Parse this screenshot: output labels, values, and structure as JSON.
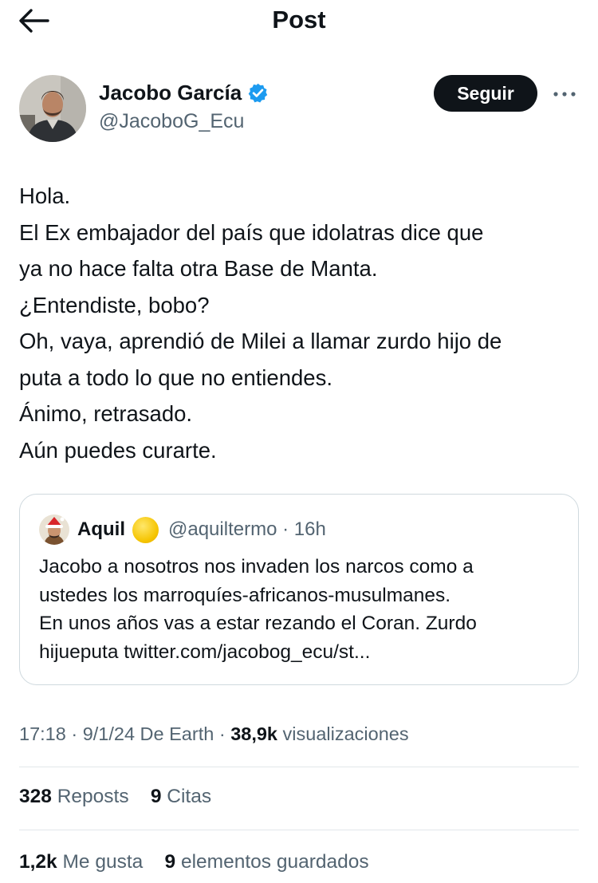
{
  "header": {
    "title": "Post"
  },
  "author": {
    "name": "Jacobo García",
    "handle": "@JacoboG_Ecu",
    "follow_label": "Seguir"
  },
  "post": {
    "lines": [
      "Hola.",
      "El Ex embajador del país que idolatras dice que",
      "ya no hace falta otra Base de Manta.",
      "¿Entendiste, bobo?",
      "Oh, vaya, aprendió de Milei a llamar zurdo hijo de",
      "puta a todo lo que no entiendes.",
      "Ánimo, retrasado.",
      "Aún puedes curarte."
    ]
  },
  "quote": {
    "name": "Aquil",
    "emoji": "yellow-circle-emoji",
    "handle_time": "@aquiltermo · 16h",
    "lines": [
      "Jacobo a nosotros nos invaden los narcos como a",
      "ustedes los marroquíes-africanos-musulmanes.",
      "En unos años vas a estar rezando el Coran. Zurdo",
      "hijueputa twitter.com/jacobog_ecu/st..."
    ]
  },
  "meta": {
    "timestamp": "17:18 · 9/1/24 De Earth · ",
    "views_count": "38,9k",
    "views_label": " visualizaciones"
  },
  "stats": {
    "reposts_count": "328",
    "reposts_label": "Reposts",
    "quotes_count": "9",
    "quotes_label": "Citas",
    "likes_count": "1,2k",
    "likes_label": "Me gusta",
    "bookmarks_count": "9",
    "bookmarks_label": "elementos guardados"
  },
  "colors": {
    "text_primary": "#0f1419",
    "text_secondary": "#536471",
    "verified_blue": "#1d9bf0",
    "border": "#cfd9de"
  },
  "icons": {
    "back": "arrow-left-icon",
    "verified": "verified-badge-icon",
    "more": "more-horizontal-icon"
  }
}
